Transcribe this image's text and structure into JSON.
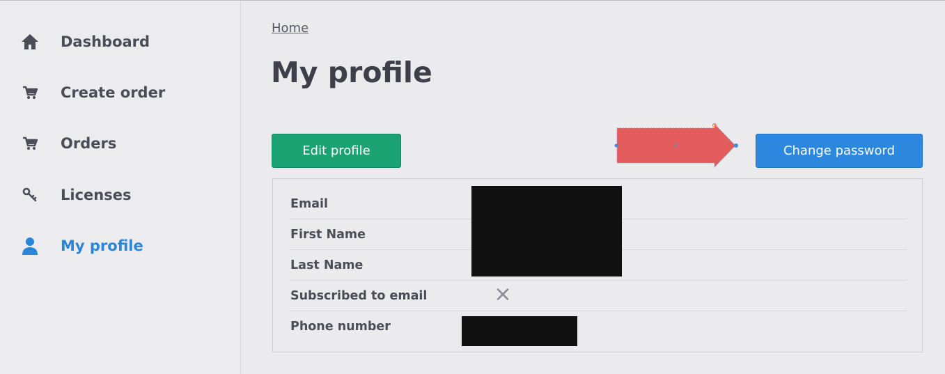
{
  "sidebar": {
    "items": [
      {
        "label": "Dashboard",
        "icon": "home-icon",
        "active": false
      },
      {
        "label": "Create order",
        "icon": "cart-icon",
        "active": false
      },
      {
        "label": "Orders",
        "icon": "cart-icon",
        "active": false
      },
      {
        "label": "Licenses",
        "icon": "key-icon",
        "active": false
      },
      {
        "label": "My profile",
        "icon": "user-icon",
        "active": true
      }
    ]
  },
  "breadcrumb": {
    "home": "Home"
  },
  "page": {
    "title": "My profile"
  },
  "actions": {
    "edit_label": "Edit profile",
    "change_password_label": "Change password"
  },
  "profile": {
    "fields": [
      {
        "label": "Email"
      },
      {
        "label": "First Name"
      },
      {
        "label": "Last Name"
      },
      {
        "label": "Subscribed to email",
        "value_icon": "x-icon"
      },
      {
        "label": "Phone number"
      }
    ]
  },
  "colors": {
    "accent": "#2a86d9",
    "edit_button": "#1aa272",
    "change_button": "#2c87de",
    "annotation_arrow": "#e25c5c",
    "redaction": "#111111"
  }
}
